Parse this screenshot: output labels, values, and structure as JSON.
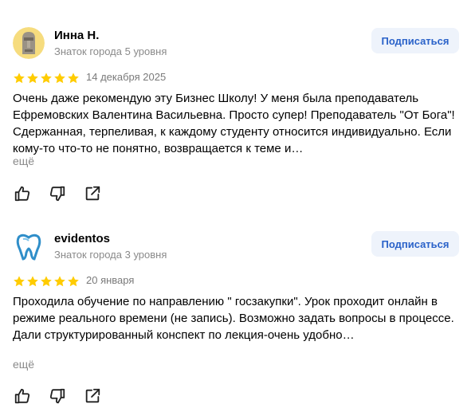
{
  "reviews": [
    {
      "author": "Инна Н.",
      "level": "Знаток города 5 уровня",
      "subscribe_label": "Подписаться",
      "rating": 5,
      "date": "14 декабря 2025",
      "text": "Очень даже рекомендую эту Бизнес Школу! У меня была преподаватель Ефремовских Валентина Васильевна. Просто супер! Преподаватель \"От Бога\"! Сдержанная, терпеливая, к каждому студенту относится индивидуально. Если кому-то что-то не понятно, возвращается к теме и…",
      "more_label": "ещё",
      "avatar_icon": "moai-statue-icon"
    },
    {
      "author": "evidentos",
      "level": "Знаток города 3 уровня",
      "subscribe_label": "Подписаться",
      "rating": 5,
      "date": "20 января",
      "text": "Проходила обучение по направлению \" госзакупки\". Урок проходит онлайн в режиме реального времени (не запись). Возможно задать вопросы в процессе. Дали структурированный конспект по лекция-очень удобно…",
      "more_label": "ещё",
      "avatar_icon": "tooth-logo-icon"
    }
  ],
  "colors": {
    "star": "#ffcc00",
    "subscribe_bg": "#eef3fb",
    "subscribe_text": "#2a62c9",
    "muted_text": "#8a8a8a"
  }
}
